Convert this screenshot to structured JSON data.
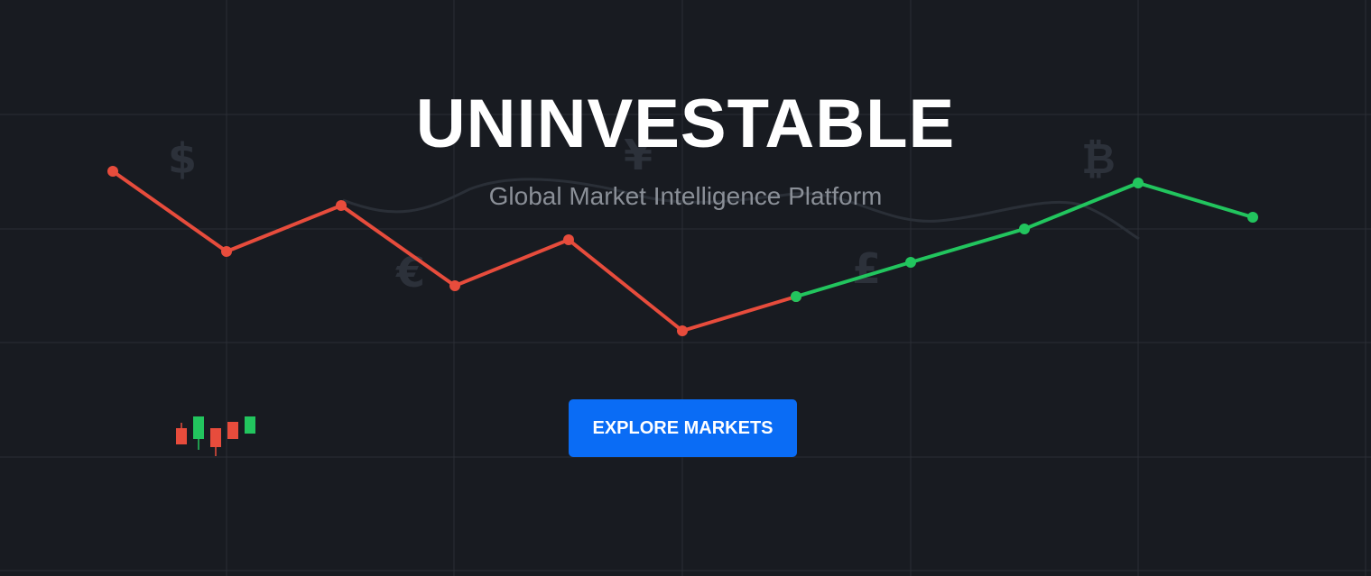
{
  "hero": {
    "title": "UNINVESTABLE",
    "subtitle": "Global Market Intelligence Platform",
    "cta_label": "EXPLORE MARKETS"
  },
  "background": {
    "currency_symbols": [
      "$",
      "€",
      "¥",
      "£",
      "₿"
    ],
    "candlesticks": [
      {
        "direction": "down"
      },
      {
        "direction": "up"
      },
      {
        "direction": "down"
      },
      {
        "direction": "down"
      },
      {
        "direction": "up"
      }
    ]
  },
  "colors": {
    "background": "#181b21",
    "grid": "#2a2e35",
    "decline": "#e74c3c",
    "rise": "#22c55e",
    "accent_button": "#0a6cf5",
    "title": "#ffffff",
    "subtitle": "#8a8f97",
    "currency_symbol": "#2c313a"
  }
}
